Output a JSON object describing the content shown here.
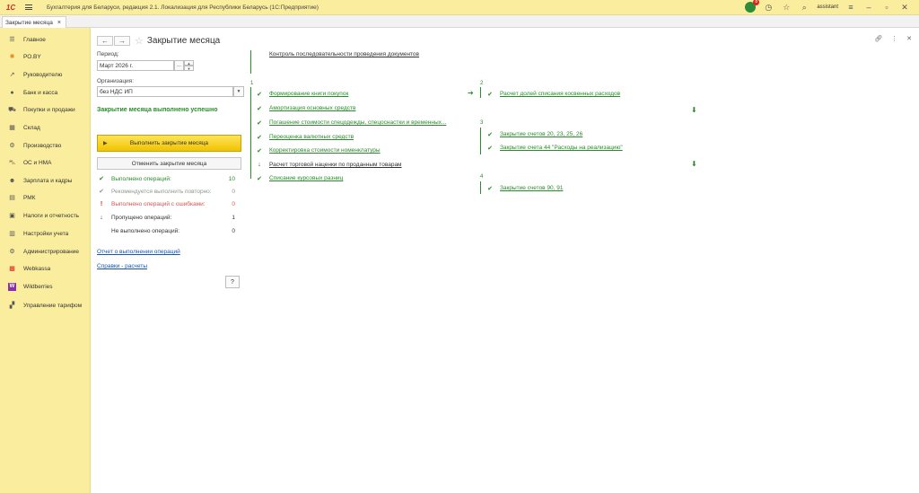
{
  "titlebar": {
    "logo": "1С",
    "app_title": "Бухгалтерия для Беларуси, редакция 2.1. Локализация для Республики Беларусь   (1С:Предприятие)",
    "notification_count": "8",
    "user": "assistant"
  },
  "tabs": [
    {
      "label": "Закрытие месяца",
      "close": "×"
    }
  ],
  "sidebar": {
    "items": [
      {
        "label": "Главное",
        "icon": "menu-icon"
      },
      {
        "label": "РО.BY",
        "icon": "sun-icon"
      },
      {
        "label": "Руководителю",
        "icon": "chart-icon"
      },
      {
        "label": "Банк и касса",
        "icon": "coin-icon"
      },
      {
        "label": "Покупки и продажи",
        "icon": "cart-icon"
      },
      {
        "label": "Склад",
        "icon": "warehouse-icon"
      },
      {
        "label": "Производство",
        "icon": "factory-icon"
      },
      {
        "label": "ОС и НМА",
        "icon": "car-icon"
      },
      {
        "label": "Зарплата и кадры",
        "icon": "people-icon"
      },
      {
        "label": "РМК",
        "icon": "cashdesk-icon"
      },
      {
        "label": "Налоги и отчетность",
        "icon": "document-icon"
      },
      {
        "label": "Настройки учета",
        "icon": "settings-doc-icon"
      },
      {
        "label": "Администрирование",
        "icon": "gear-icon"
      },
      {
        "label": "Webkassa",
        "icon": "webkassa-icon"
      },
      {
        "label": "Wildberries",
        "icon": "wildberries-icon"
      },
      {
        "label": "Управление тарифом",
        "icon": "grid-icon"
      }
    ]
  },
  "header": {
    "back": "←",
    "forward": "→",
    "title": "Закрытие месяца"
  },
  "form": {
    "period_label": "Период:",
    "period_value": "Март 2026 г.",
    "period_select": "...",
    "org_label": "Организация:",
    "org_value": "без НДС ИП",
    "status": "Закрытие месяца выполнено успешно",
    "run_button": "Выполнить закрытие месяца",
    "cancel_button": "Отменить закрытие месяца"
  },
  "stats": [
    {
      "label": "Выполнено операций:",
      "value": "10",
      "color": "#2b8a2b",
      "icon": "check-icon"
    },
    {
      "label": "Рекомендуется выполнить повторно:",
      "value": "0",
      "color": "#8a9a8a",
      "icon": "check-icon"
    },
    {
      "label": "Выполнено операций с ошибками:",
      "value": "0",
      "color": "#d9534f",
      "icon": "error-icon"
    },
    {
      "label": "Пропущено операций:",
      "value": "1",
      "color": "#333333",
      "icon": "skip-icon"
    },
    {
      "label": "Не выполнено операций:",
      "value": "0",
      "color": "#333333",
      "icon": "none"
    }
  ],
  "links": {
    "report": "Отчет о выполнении операций",
    "help": "Справки - расчеты",
    "help_btn": "?"
  },
  "control_doc": "Контроль последовательности проведения документов",
  "columns": [
    {
      "number": "1",
      "steps": [
        {
          "label": "Формирование книги покупок",
          "icon": "double-check-icon",
          "done": true
        },
        {
          "label": "Амортизация основных средств",
          "icon": "check-icon",
          "done": true
        },
        {
          "label": "Погашение стоимости спецодежды, спецоснастки и временных...",
          "icon": "check-icon",
          "done": true
        },
        {
          "label": "Переоценка валютных средств",
          "icon": "check-icon",
          "done": true
        },
        {
          "label": "Корректировка стоимости номенклатуры",
          "icon": "check-icon",
          "done": true
        },
        {
          "label": "Расчет торговой наценки по проданным товарам",
          "icon": "skip-icon",
          "done": false
        },
        {
          "label": "Списание курсовых разниц",
          "icon": "check-icon",
          "done": true
        }
      ]
    },
    {
      "number": "2",
      "steps": [
        {
          "label": "Расчет долей списания косвенных расходов",
          "icon": "check-icon",
          "done": true
        }
      ]
    },
    {
      "number": "3",
      "steps": [
        {
          "label": "Закрытие счетов 20, 23, 25, 26",
          "icon": "check-icon",
          "done": true
        },
        {
          "label": "Закрытие счета 44 \"Расходы на реализацию\"",
          "icon": "check-icon",
          "done": true
        }
      ]
    },
    {
      "number": "4",
      "steps": [
        {
          "label": "Закрытие счетов 90, 91",
          "icon": "check-icon",
          "done": true
        }
      ]
    }
  ]
}
